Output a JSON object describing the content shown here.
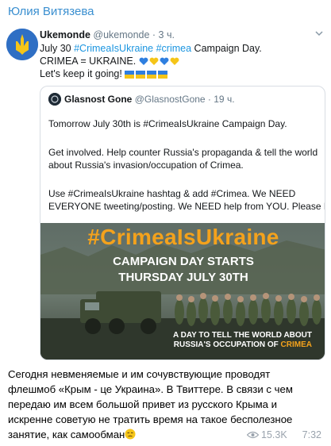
{
  "channel": {
    "name": "Юлия Витязева"
  },
  "tweet": {
    "display_name": "Ukemonde",
    "handle_time": "@ukemonde · 3 ч.",
    "line1_prefix": "July 30 ",
    "line1_tag1": "#CrimeaIsUkraine",
    "line1_tag2": "#crimea",
    "line1_suffix": " Campaign Day.",
    "line2": "CRIMEA = UKRAINE.",
    "line3": "Let's keep it going!",
    "heart_colors": [
      "#2f7fe0",
      "#f5c518",
      "#2f7fe0",
      "#f5c518"
    ]
  },
  "quoted": {
    "display_name": "Glasnost Gone",
    "handle_time": "@GlasnostGone · 19 ч.",
    "lines": [
      "Tomorrow July 30th is #CrimeaIsUkraine Campaign Day.",
      "Get involved. Help counter Russia's propaganda & tell the world",
      "about Russia's invasion/occupation of Crimea.",
      "Use #CrimeaIsUkraine hashtag & add #Crimea. We NEED",
      "EVERYONE tweeting/posting. We NEED help from YOU. Please RT."
    ],
    "media": {
      "hashtag": "#CrimeaIsUkraine",
      "line1": "CAMPAIGN DAY STARTS",
      "line2": "THURSDAY JULY 30TH",
      "sub1": "A DAY TO TELL THE WORLD ABOUT",
      "sub2_prefix": "RUSSIA'S OCCUPATION OF ",
      "sub2_accent": "CRIMEA"
    }
  },
  "caption": {
    "lines": [
      "Сегодня невменяемые и им сочувствующие проводят",
      "флешмоб «Крым - це Украина». В Твиттере. В связи с чем",
      "передаю им всем большой привет из русского Крыма и",
      "искренне советую не тратить время на такое бесполезное",
      "занятие, как самообман"
    ]
  },
  "meta": {
    "views": "15.3K",
    "time": "7:32"
  },
  "colors": {
    "link": "#1b95e0",
    "channel": "#3a8fd0",
    "accent": "#f4a21c"
  }
}
